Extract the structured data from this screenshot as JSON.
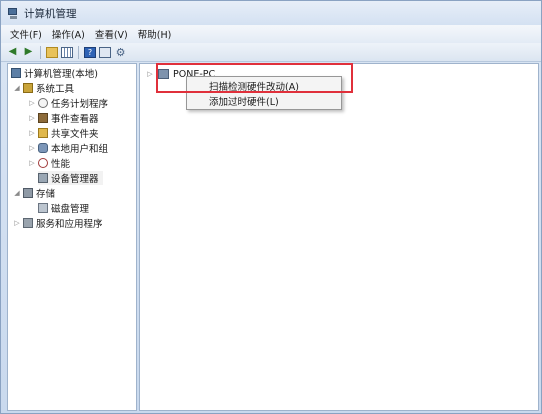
{
  "window": {
    "title": "计算机管理"
  },
  "menu": [
    "文件(F)",
    "操作(A)",
    "查看(V)",
    "帮助(H)"
  ],
  "toolbar": {
    "icons": [
      "back-arrow",
      "forward-arrow",
      "up-folder",
      "show-hide-tree",
      "help",
      "properties",
      "scan-hardware"
    ],
    "help_glyph": "?"
  },
  "tree": [
    {
      "label": "计算机管理(本地)",
      "icon": "computer-management",
      "level": 0
    },
    {
      "label": "系统工具",
      "icon": "system-tools",
      "level": 1,
      "expanded": true
    },
    {
      "label": "任务计划程序",
      "icon": "task-scheduler",
      "level": 2
    },
    {
      "label": "事件查看器",
      "icon": "event-viewer",
      "level": 2
    },
    {
      "label": "共享文件夹",
      "icon": "shared-folders",
      "level": 2
    },
    {
      "label": "本地用户和组",
      "icon": "local-users",
      "level": 2
    },
    {
      "label": "性能",
      "icon": "performance",
      "level": 2
    },
    {
      "label": "设备管理器",
      "icon": "device-manager",
      "level": 2,
      "selected": true
    },
    {
      "label": "存储",
      "icon": "storage",
      "level": 1,
      "expanded": true
    },
    {
      "label": "磁盘管理",
      "icon": "disk-management",
      "level": 2
    },
    {
      "label": "服务和应用程序",
      "icon": "services-apps",
      "level": 1
    }
  ],
  "device_tree": {
    "node_label": "PONE-PC"
  },
  "context_menu": {
    "items": [
      "扫描检测硬件改动(A)",
      "添加过时硬件(L)"
    ]
  },
  "colors": {
    "highlight": "#e0303b",
    "titlebar": "#d4e1f2"
  }
}
